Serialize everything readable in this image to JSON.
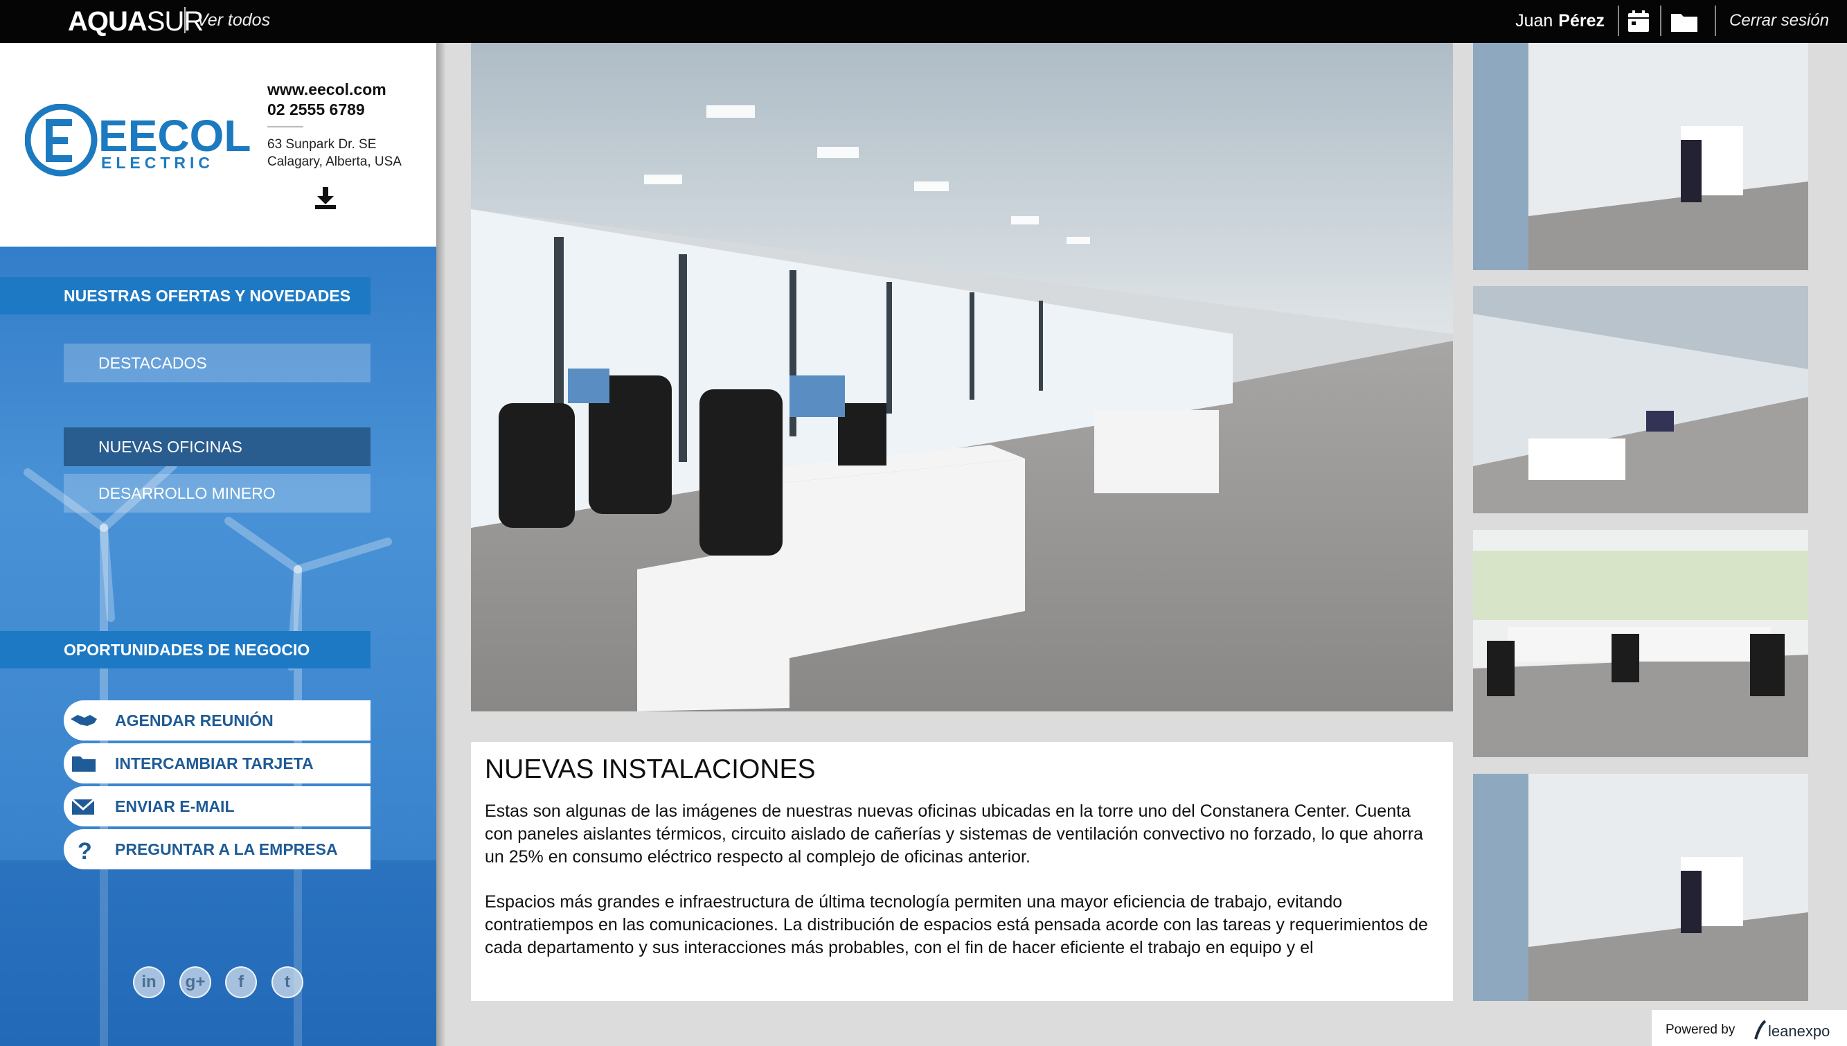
{
  "topbar": {
    "brand_bold": "AQUA",
    "brand_light": "SUR",
    "see_all": "Ver todos",
    "user_first": "Juan",
    "user_last": "Pérez",
    "calendar_icon": "calendar-icon",
    "folder_icon": "folder-icon",
    "logout": "Cerrar sesión"
  },
  "company": {
    "logo_text": "EECOL",
    "logo_subtext": "ELECTRIC",
    "website": "www.eecol.com",
    "phone": "02 2555 6789",
    "address_line1": "63 Sunpark Dr. SE",
    "address_line2": "Calagary, Alberta, USA",
    "download_icon": "download-icon"
  },
  "sidebar": {
    "offers_heading": "NUESTRAS OFERTAS Y NOVEDADES",
    "menu": [
      {
        "label": "DESTACADOS",
        "active": false
      },
      {
        "label": "NUEVAS OFICINAS",
        "active": true
      },
      {
        "label": "DESARROLLO MINERO",
        "active": false
      }
    ],
    "business_heading": "OPORTUNIDADES DE NEGOCIO",
    "actions": [
      {
        "label": "AGENDAR REUNIÓN",
        "icon": "handshake-icon"
      },
      {
        "label": "INTERCAMBIAR TARJETA",
        "icon": "card-folder-icon"
      },
      {
        "label": "ENVIAR E-MAIL",
        "icon": "envelope-icon"
      },
      {
        "label": "PREGUNTAR A LA EMPRESA",
        "icon": "question-icon"
      }
    ],
    "social": [
      {
        "label": "in",
        "icon": "linkedin-icon"
      },
      {
        "label": "g+",
        "icon": "googleplus-icon"
      },
      {
        "label": "f",
        "icon": "facebook-icon"
      },
      {
        "label": "t",
        "icon": "twitter-icon"
      }
    ]
  },
  "article": {
    "title": "NUEVAS INSTALACIONES",
    "paragraphs": [
      "Estas son algunas de las imágenes de nuestras nuevas oficinas ubicadas en la torre uno del Constanera Center. Cuenta con paneles aislantes térmicos, circuito aislado de cañerías y sistemas de ventilación convectivo no forzado, lo que ahorra un 25% en consumo eléctrico respecto al complejo de oficinas anterior.",
      "Espacios más grandes e infraestructura de última tecnología permiten una mayor eficiencia de trabajo, evitando contratiempos en las comunicaciones. La distribución de espacios está pensada acorde con las tareas y requerimientos de cada departamento y sus interacciones más probables, con el fin de hacer eficiente el trabajo en equipo y el"
    ]
  },
  "footer": {
    "powered_by": "Powered by",
    "partner": "leanexpo"
  },
  "colors": {
    "topbar": "#050505",
    "sidebar_blue": "#2f78c3",
    "heading_blue": "#1e79c4",
    "active_item": "#295c8f",
    "action_text": "#1f5b96"
  }
}
